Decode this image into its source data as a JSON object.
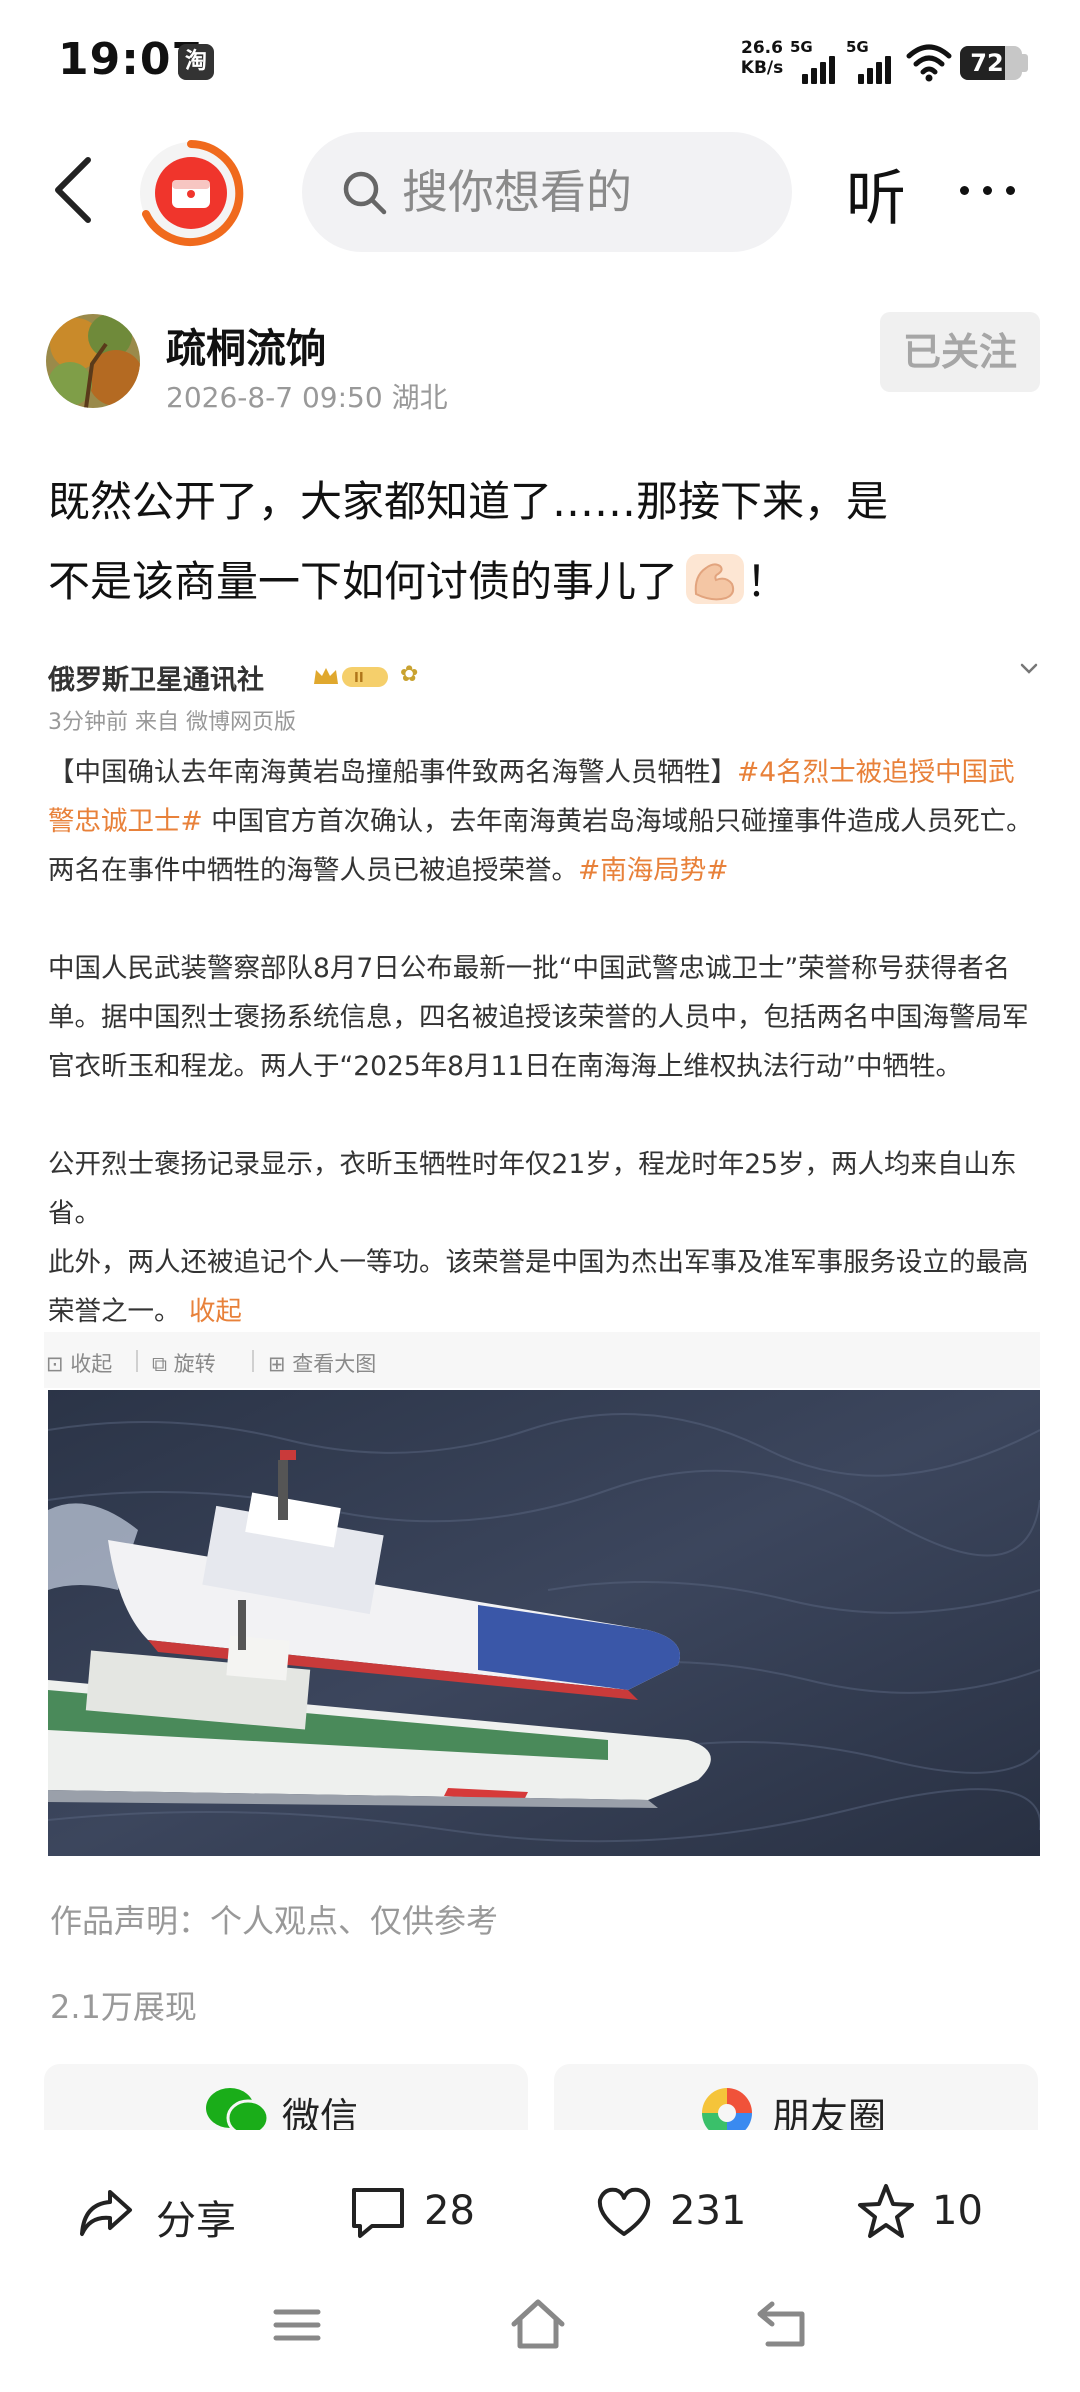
{
  "status_bar": {
    "time": "19:07",
    "app_badge": "淘",
    "net_speed_value": "26.6",
    "net_speed_unit": "KB/s",
    "signal_1": "5G",
    "signal_2": "5G",
    "battery_level": "72"
  },
  "nav": {
    "search_placeholder": "搜你想看的",
    "listen_label": "听"
  },
  "author": {
    "name": "疏桐流饷",
    "timestamp": "2026-8-7 09:50",
    "location": "湖北",
    "follow_label": "已关注"
  },
  "post": {
    "text_line1": "既然公开了，大家都知道了……那接下来，是",
    "text_line2": "不是该商量一下如何讨债的事儿了",
    "text_end": "！"
  },
  "embedded": {
    "account": "俄罗斯卫星通讯社",
    "badge": "II",
    "meta": "3分钟前 来自 微博网页版",
    "p1_title": "【中国确认去年南海黄岩岛撞船事件致两名海警人员牺牲】",
    "p1_tag": "#4名烈士被追授中国武警忠诚卫士#",
    "p1_text": " 中国官方首次确认，去年南海黄岩岛海域船只碰撞事件造成人员死亡。两名在事件中牺牲的海警人员已被追授荣誉。",
    "p1_tag2": "#南海局势#",
    "p2": "中国人民武装警察部队8月7日公布最新一批“中国武警忠诚卫士”荣誉称号获得者名单。据中国烈士褒扬系统信息，四名被追授该荣誉的人员中，包括两名中国海警局军官衣昕玉和程龙。两人于“2025年8月11日在南海海上维权执法行动”中牺牲。",
    "p3": "公开烈士褒扬记录显示，衣昕玉牺牲时年仅21岁，程龙时年25岁，两人均来自山东省。",
    "p4": "此外，两人还被追记个人一等功。该荣誉是中国为杰出军事及准军事服务设立的最高荣誉之一。",
    "collapse_link": "收起",
    "actions": [
      "收起",
      "旋转",
      "查看大图"
    ]
  },
  "disclaimer": "作品声明：个人观点、仅供参考",
  "views": "2.1万展现",
  "share_targets": [
    "微信",
    "朋友圈"
  ],
  "action_bar": {
    "share_label": "分享",
    "comment_count": "28",
    "like_count": "231",
    "favorite_count": "10"
  },
  "colors": {
    "accent_orange": "#f06a1d",
    "logo_red": "#f0352c",
    "tag_orange": "#e8813a",
    "wechat_green": "#1aad19"
  }
}
